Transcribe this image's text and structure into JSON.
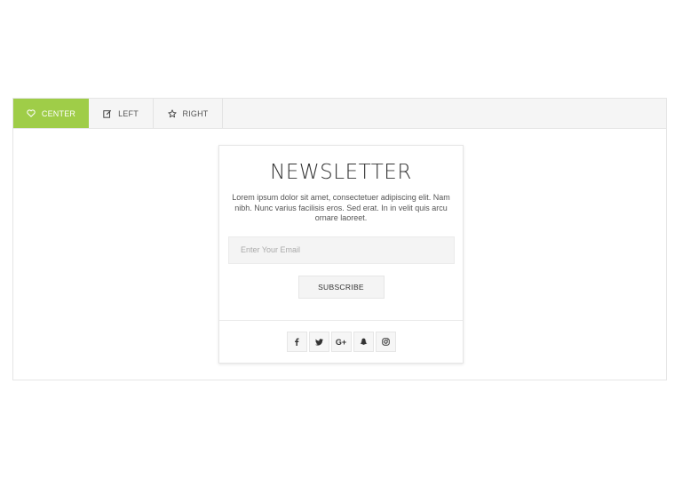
{
  "tabs": [
    {
      "label": "CENTER",
      "icon": "heart-icon",
      "active": true
    },
    {
      "label": "LEFT",
      "icon": "edit-icon",
      "active": false
    },
    {
      "label": "RIGHT",
      "icon": "star-icon",
      "active": false
    }
  ],
  "newsletter": {
    "title": "NEWSLETTER",
    "description": "Lorem ipsum dolor sit amet, consectetuer adipiscing elit. Nam nibh. Nunc varius facilisis eros. Sed erat. In in velit quis arcu ornare laoreet.",
    "email_placeholder": "Enter Your Email",
    "subscribe_label": "SUBSCRIBE"
  },
  "social": [
    {
      "name": "facebook-icon"
    },
    {
      "name": "twitter-icon"
    },
    {
      "name": "google-plus-icon",
      "glyph": "G+"
    },
    {
      "name": "snapchat-icon"
    },
    {
      "name": "instagram-icon"
    }
  ],
  "colors": {
    "accent": "#9fcd48",
    "tabbar_bg": "#f5f5f5",
    "field_bg": "#f4f4f4"
  }
}
